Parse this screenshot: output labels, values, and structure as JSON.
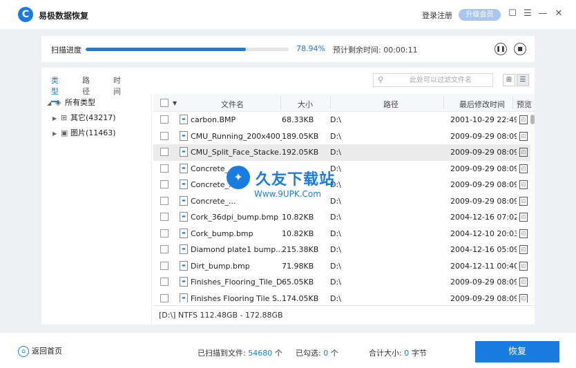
{
  "app": {
    "logo_glyph": "C",
    "title": "易极数据恢复",
    "login_label": "登录注册",
    "vip_label": "升级会员",
    "accent": "#1a7ce0"
  },
  "window_controls": [
    {
      "name": "feedback-icon",
      "glyph": "☐"
    },
    {
      "name": "menu-icon",
      "glyph": "☰"
    },
    {
      "name": "minimize-icon",
      "glyph": "—"
    },
    {
      "name": "close-icon",
      "glyph": "✕"
    }
  ],
  "scan": {
    "label": "扫描进度",
    "progress": 0.7894,
    "progress_text": "78.94%",
    "remaining_label": "预计剩余时间:",
    "remaining_value": "00:00:11",
    "pause_glyph": "❚❚",
    "stop_glyph": "■"
  },
  "tabs": [
    "类型",
    "路径",
    "时间"
  ],
  "search": {
    "placeholder": "此处可以过滤文件名",
    "value": ""
  },
  "tree": {
    "root": "所有类型",
    "children": [
      {
        "label": "其它(43217)",
        "icon": "grid-icon"
      },
      {
        "label": "图片(11463)",
        "icon": "image-icon"
      }
    ]
  },
  "table": {
    "columns": {
      "name": "文件名",
      "size": "大小",
      "path": "路径",
      "modified": "最后修改时间",
      "preview": "预览"
    },
    "rows": [
      {
        "name": "carbon.BMP",
        "size": "68.33KB",
        "path": "D:\\",
        "modified": "2001-10-29 22:49",
        "selected": false
      },
      {
        "name": "CMU_Running_200x400_...",
        "size": "189.05KB",
        "path": "D:\\",
        "modified": "2009-09-29 08:09",
        "selected": false
      },
      {
        "name": "CMU_Split_Face_Stacke...",
        "size": "192.05KB",
        "path": "D:\\",
        "modified": "2009-09-29 08:09",
        "selected": true
      },
      {
        "name": "Concrete_...",
        "size": "",
        "path": "D:\\",
        "modified": "2009-09-29 08:09",
        "selected": false
      },
      {
        "name": "Concrete_...",
        "size": "",
        "path": "D:\\",
        "modified": "2009-09-29 08:09",
        "selected": false
      },
      {
        "name": "Concrete_...",
        "size": "",
        "path": "D:\\",
        "modified": "2009-09-29 08:09",
        "selected": false
      },
      {
        "name": "Cork_36dpi_bump.bmp",
        "size": "10.82KB",
        "path": "D:\\",
        "modified": "2004-12-16 07:02",
        "selected": false
      },
      {
        "name": "Cork_bump.bmp",
        "size": "10.82KB",
        "path": "D:\\",
        "modified": "2004-12-10 20:03",
        "selected": false
      },
      {
        "name": "Diamond plate1 bump....",
        "size": "215.38KB",
        "path": "D:\\",
        "modified": "2004-12-16 05:09",
        "selected": false
      },
      {
        "name": "Dirt_bump.bmp",
        "size": "71.98KB",
        "path": "D:\\",
        "modified": "2004-12-11 00:40",
        "selected": false
      },
      {
        "name": "Finishes_Flooring_Tile_D...",
        "size": "65.05KB",
        "path": "D:\\",
        "modified": "2009-09-29 08:09",
        "selected": false
      },
      {
        "name": "Finishes Flooring Tile S...",
        "size": "174.05KB",
        "path": "D:\\",
        "modified": "2009-09-29 08:09",
        "selected": false
      }
    ],
    "footer": "[D:\\] NTFS 112.48GB - 172.88GB"
  },
  "watermark": {
    "name": "久友下载站",
    "url": "Www.9UPK.Com"
  },
  "bottom": {
    "home_label": "返回首页",
    "scanned_label": "已扫描到文件:",
    "scanned_value": "54680",
    "scanned_unit": "个",
    "checked_label": "已勾选:",
    "checked_value": "0",
    "checked_unit": "个",
    "total_label": "合计大小:",
    "total_value": "0",
    "total_unit": "字节",
    "recover_label": "恢复"
  }
}
